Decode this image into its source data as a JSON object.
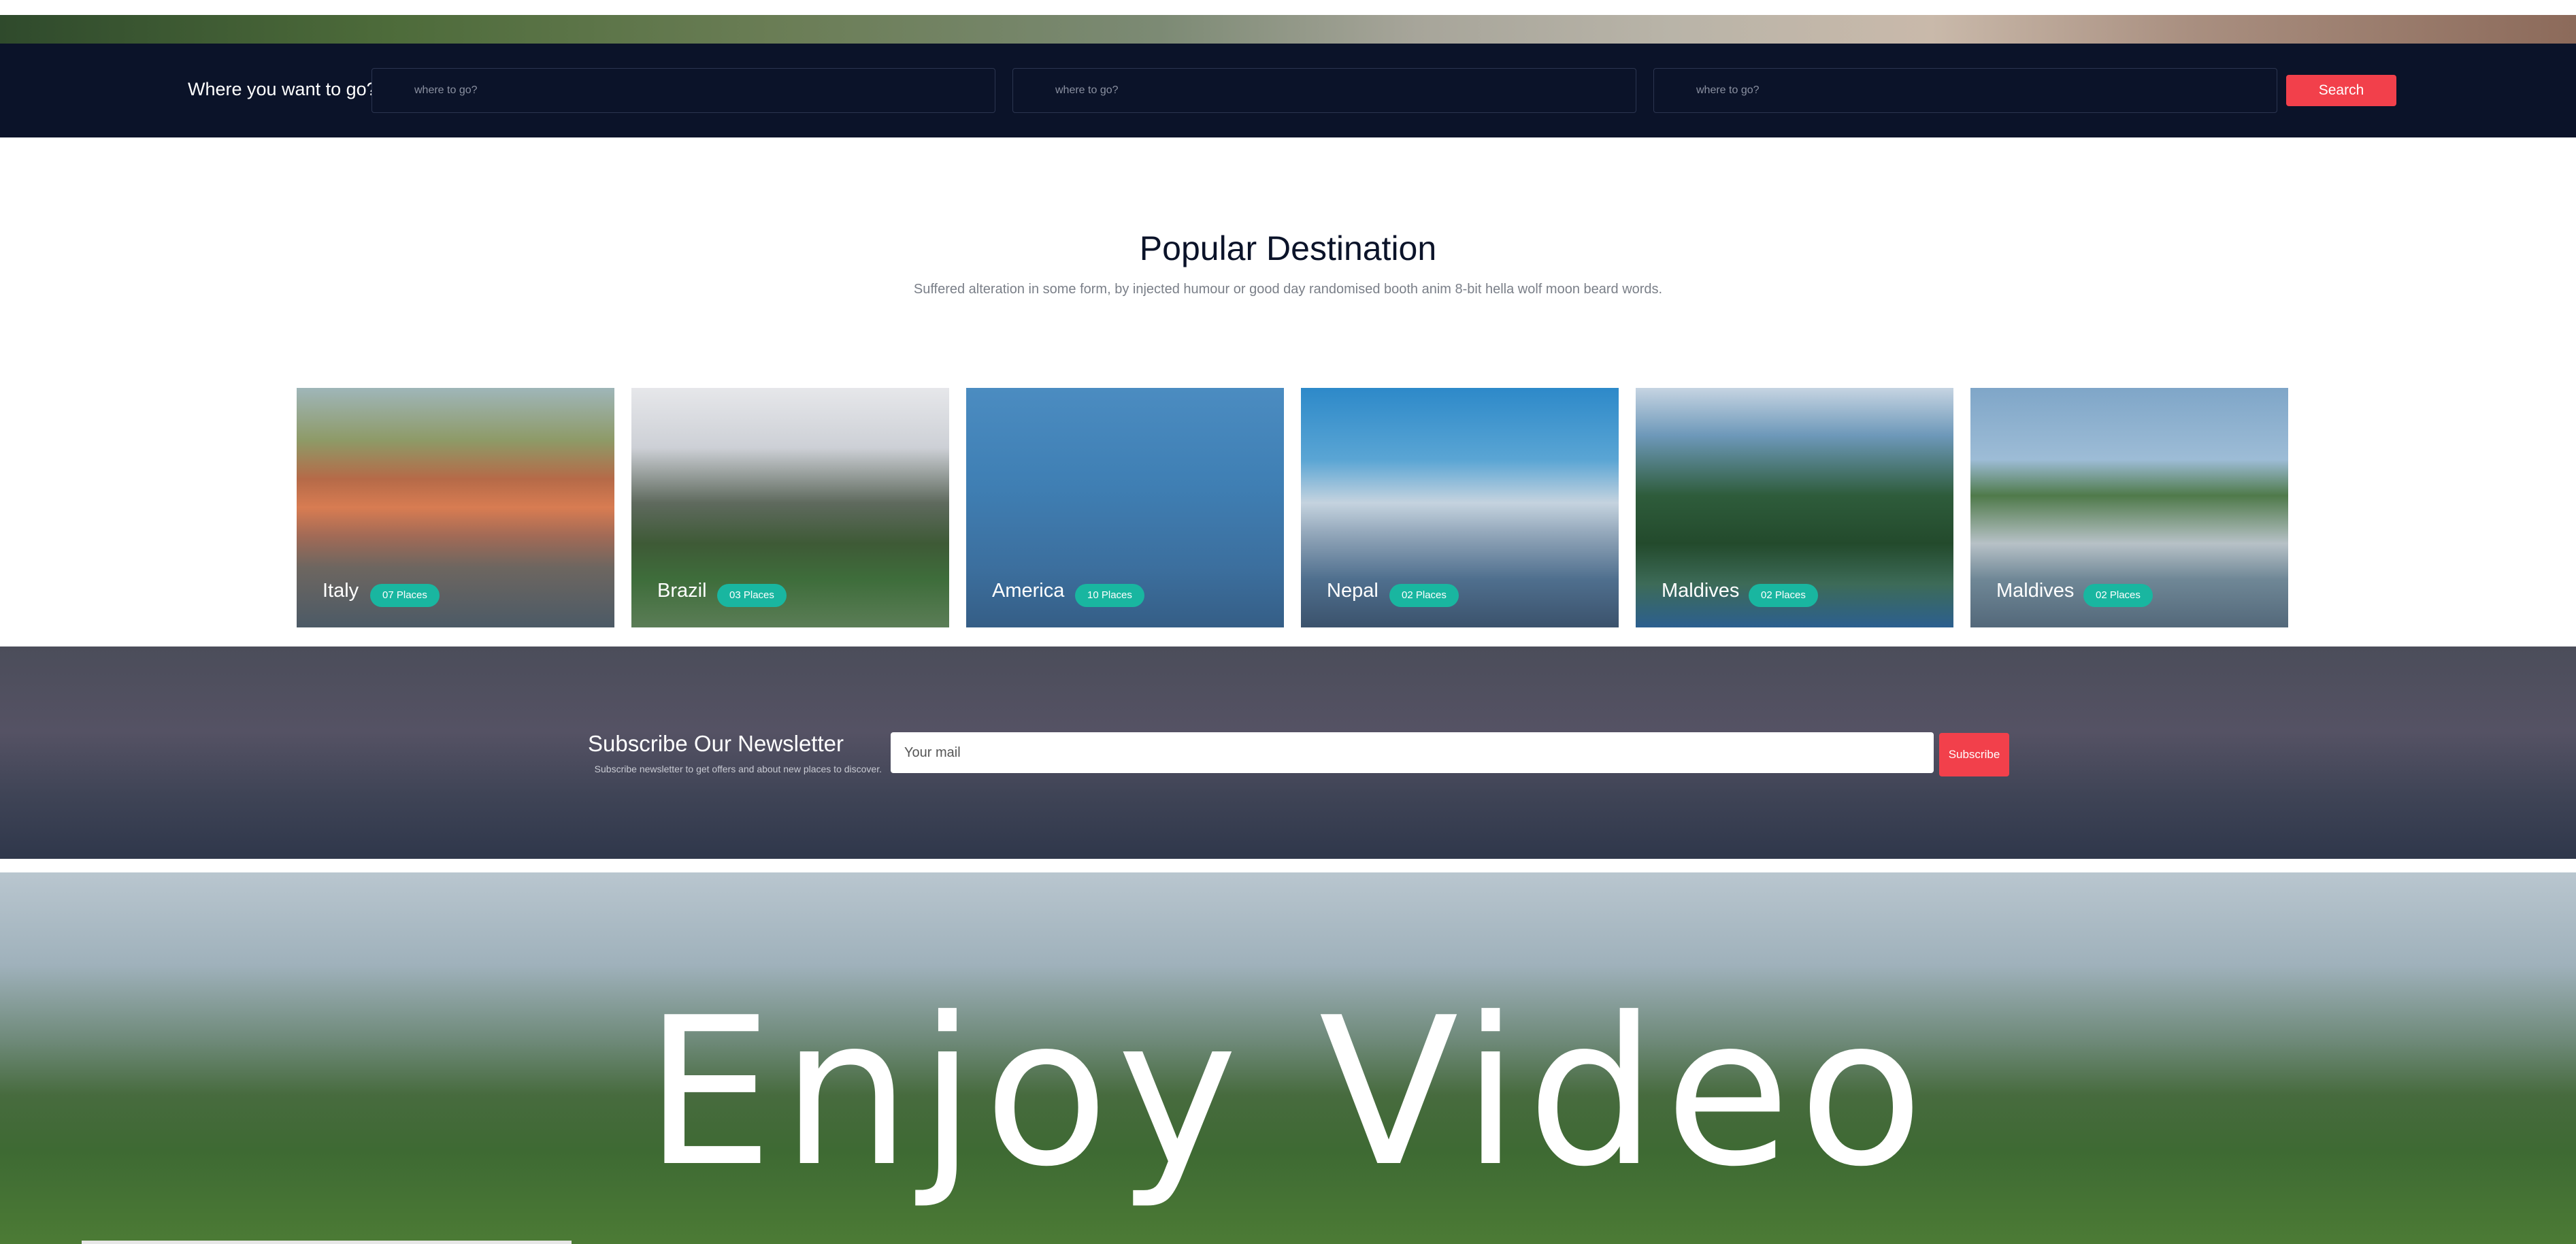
{
  "search": {
    "label": "Where you want to go?",
    "fields": [
      {
        "placeholder": "where to go?"
      },
      {
        "placeholder": "where to go?"
      },
      {
        "placeholder": "where to go?"
      }
    ],
    "button_label": "Search"
  },
  "popular": {
    "title": "Popular Destination",
    "subtitle": "Suffered alteration in some form, by injected humour or good day randomised booth anim 8-bit hella wolf moon beard words."
  },
  "destinations": [
    {
      "name": "Italy",
      "places": "07 Places"
    },
    {
      "name": "Brazil",
      "places": "03 Places"
    },
    {
      "name": "America",
      "places": "10 Places"
    },
    {
      "name": "Nepal",
      "places": "02 Places"
    },
    {
      "name": "Maldives",
      "places": "02 Places"
    },
    {
      "name": "Maldives",
      "places": "02 Places"
    }
  ],
  "newsletter": {
    "title": "Subscribe Our Newsletter",
    "subtitle": "Subscribe newsletter to get offers and about new places to discover.",
    "input_placeholder": "Your mail",
    "button_label": "Subscribe"
  },
  "video": {
    "title": "Enjoy Video"
  },
  "colors": {
    "navy": "#0b1329",
    "accent_red": "#f2404b",
    "badge_teal": "#19b6a0"
  }
}
